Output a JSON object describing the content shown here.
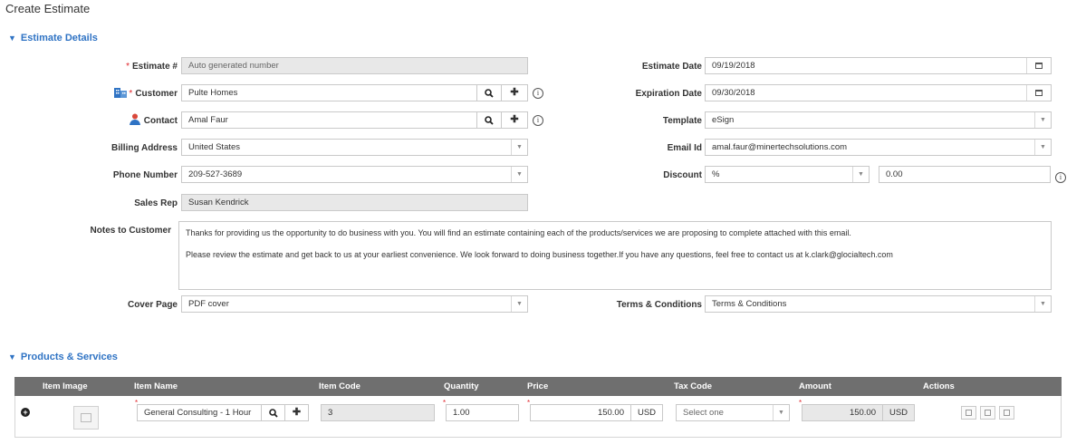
{
  "page_title": "Create Estimate",
  "sections": {
    "details": "Estimate Details",
    "products": "Products & Services"
  },
  "left": {
    "estimate_label": "Estimate #",
    "estimate_value": "Auto generated number",
    "customer_label": "Customer",
    "customer_value": "Pulte Homes",
    "contact_label": "Contact",
    "contact_value": "Amal Faur",
    "billing_label": "Billing Address",
    "billing_value": "United States",
    "phone_label": "Phone Number",
    "phone_value": "209-527-3689",
    "salesrep_label": "Sales Rep",
    "salesrep_value": "Susan Kendrick"
  },
  "right": {
    "est_date_label": "Estimate Date",
    "est_date_value": "09/19/2018",
    "exp_date_label": "Expiration Date",
    "exp_date_value": "09/30/2018",
    "template_label": "Template",
    "template_value": "eSign",
    "email_label": "Email Id",
    "email_value": "amal.faur@minertechsolutions.com",
    "discount_label": "Discount",
    "discount_type": "%",
    "discount_value": "0.00"
  },
  "notes": {
    "label": "Notes to Customer",
    "line1": "Thanks for providing us the opportunity to do business with you. You will find an estimate containing each of the products/services we are proposing to complete attached with this email.",
    "line2": "Please review the estimate and get back to us at your earliest convenience. We look forward to doing business together.If you have any questions, feel free to contact us at k.clark@glocialtech.com"
  },
  "cover": {
    "label": "Cover Page",
    "value": "PDF cover"
  },
  "terms": {
    "label": "Terms & Conditions",
    "value": "Terms & Conditions"
  },
  "table": {
    "headers": [
      "Item Image",
      "Item Name",
      "Item Code",
      "Quantity",
      "Price",
      "Tax Code",
      "Amount",
      "Actions"
    ],
    "row": {
      "item_name": "General Consulting - 1 Hour",
      "item_code": "3",
      "quantity": "1.00",
      "price": "150.00",
      "price_currency": "USD",
      "tax_placeholder": "Select one",
      "amount": "150.00",
      "amount_currency": "USD"
    }
  },
  "icons": {
    "search": "search-icon",
    "add": "plus-icon",
    "info": "info-icon",
    "calendar": "calendar-icon",
    "dropdown": "dropdown-arrow-icon",
    "building": "building-icon",
    "contact": "contact-person-icon",
    "expand_row": "expand-row-icon",
    "image_placeholder": "image-placeholder-icon",
    "edit": "edit-icon",
    "copy": "copy-icon",
    "delete": "trash-icon"
  },
  "colors": {
    "section_blue": "#2f73c4",
    "required_red": "#e0242a",
    "header_gray": "#6f6f6f",
    "readonly_gray": "#e8e8e8"
  }
}
